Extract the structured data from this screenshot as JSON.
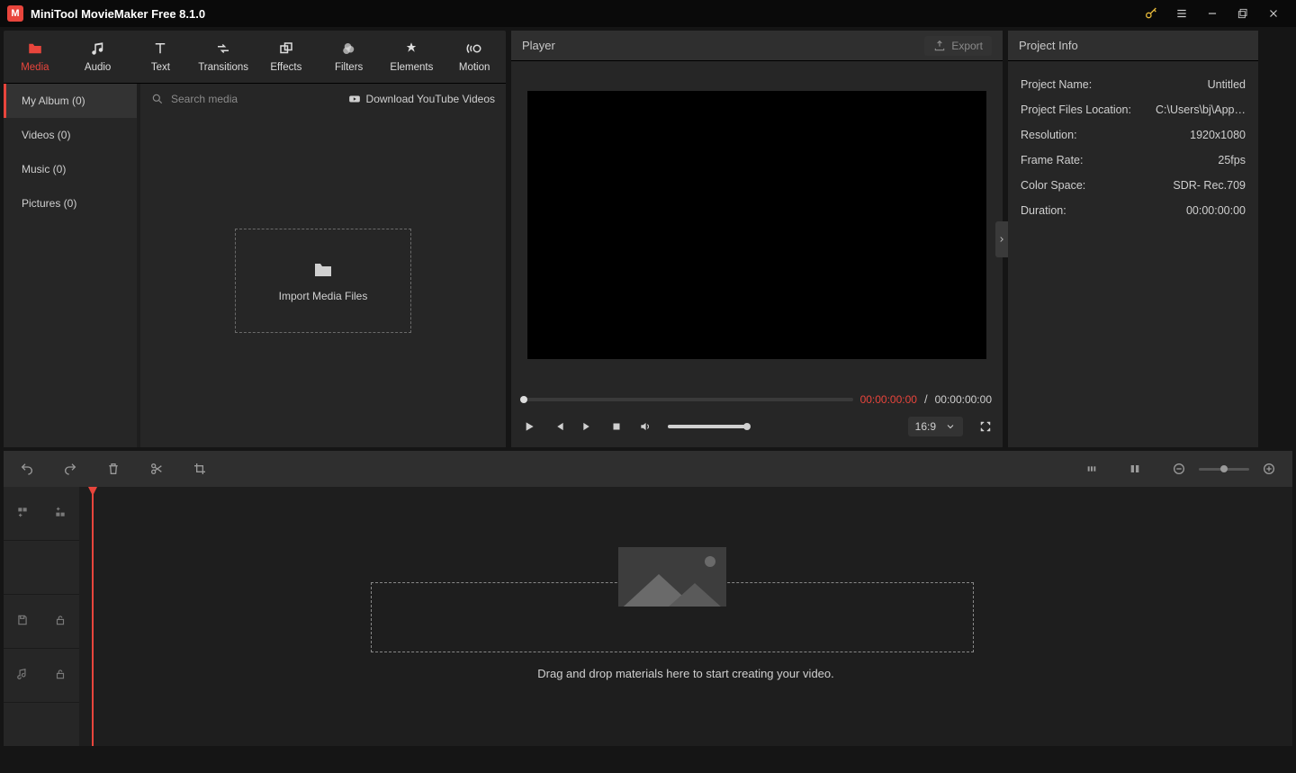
{
  "app": {
    "title": "MiniTool MovieMaker Free 8.1.0"
  },
  "tabs": {
    "media": "Media",
    "audio": "Audio",
    "text": "Text",
    "transitions": "Transitions",
    "effects": "Effects",
    "filters": "Filters",
    "elements": "Elements",
    "motion": "Motion"
  },
  "albums": {
    "myalbum": "My Album (0)",
    "videos": "Videos (0)",
    "music": "Music (0)",
    "pictures": "Pictures (0)"
  },
  "search": {
    "placeholder": "Search media"
  },
  "yt": {
    "label": "Download YouTube Videos"
  },
  "import": {
    "label": "Import Media Files"
  },
  "player": {
    "title": "Player",
    "export": "Export",
    "time_current": "00:00:00:00",
    "time_separator": " / ",
    "time_total": "00:00:00:00",
    "ratio": "16:9"
  },
  "info": {
    "title": "Project Info",
    "rows": [
      {
        "k": "Project Name:",
        "v": "Untitled"
      },
      {
        "k": "Project Files Location:",
        "v": "C:\\Users\\bj\\App…"
      },
      {
        "k": "Resolution:",
        "v": "1920x1080"
      },
      {
        "k": "Frame Rate:",
        "v": "25fps"
      },
      {
        "k": "Color Space:",
        "v": "SDR- Rec.709"
      },
      {
        "k": "Duration:",
        "v": "00:00:00:00"
      }
    ]
  },
  "timeline": {
    "drop_text": "Drag and drop materials here to start creating your video."
  }
}
